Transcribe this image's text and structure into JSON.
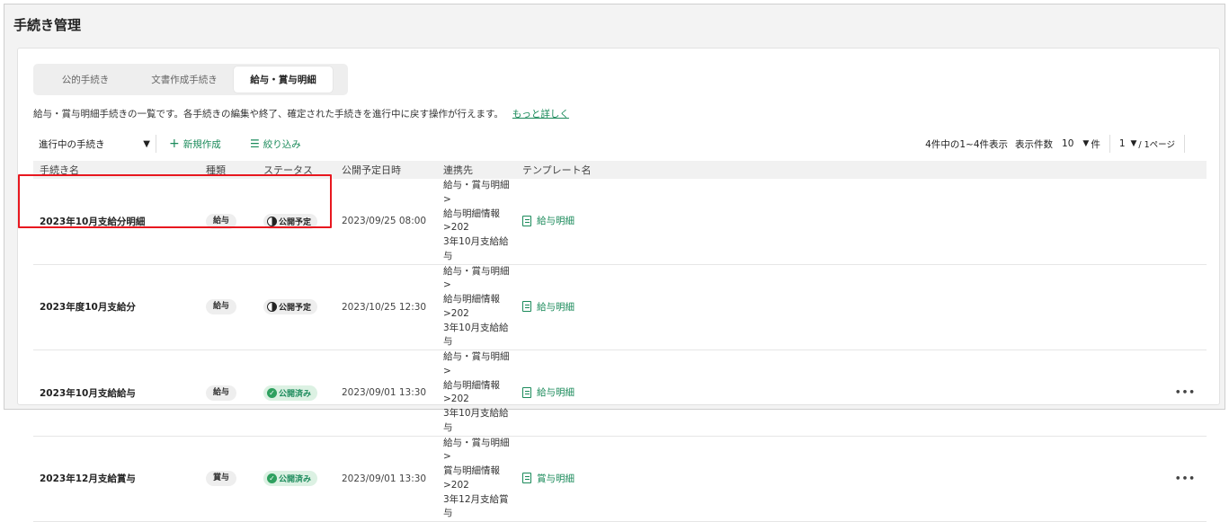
{
  "page": {
    "title": "手続き管理"
  },
  "tabs": [
    {
      "label": "公的手続き",
      "active": false
    },
    {
      "label": "文書作成手続き",
      "active": false
    },
    {
      "label": "給与・賞与明細",
      "active": true
    }
  ],
  "description": {
    "text": "給与・賞与明細手続きの一覧です。各手続きの編集や終了、確定された手続きを進行中に戻す操作が行えます。",
    "link": "もっと詳しく"
  },
  "toolbar": {
    "filter_value": "進行中の手続き",
    "new_label": "新規作成",
    "narrow_label": "絞り込み"
  },
  "pager": {
    "summary": "4件中の1~4件表示",
    "per_page_label": "表示件数",
    "per_page_value": "10",
    "per_page_unit": "件",
    "page_value": "1",
    "page_total": "/ 1ページ"
  },
  "table": {
    "headers": [
      "手続き名",
      "種類",
      "ステータス",
      "公開予定日時",
      "連携先",
      "テンプレート名"
    ],
    "rows": [
      {
        "name": "2023年10月支給分明細",
        "type": "給与",
        "status": "公開予定",
        "status_kind": "scheduled",
        "date": "2023/09/25 08:00",
        "link_1": "給与・賞与明細>",
        "link_2": "給与明細情報>202",
        "link_3": "3年10月支給給与",
        "template": "給与明細",
        "more": ""
      },
      {
        "name": "2023年度10月支給分",
        "type": "給与",
        "status": "公開予定",
        "status_kind": "scheduled",
        "date": "2023/10/25 12:30",
        "link_1": "給与・賞与明細>",
        "link_2": "給与明細情報>202",
        "link_3": "3年10月支給給与",
        "template": "給与明細",
        "more": ""
      },
      {
        "name": "2023年10月支給給与",
        "type": "給与",
        "status": "公開済み",
        "status_kind": "published",
        "date": "2023/09/01 13:30",
        "link_1": "給与・賞与明細>",
        "link_2": "給与明細情報>202",
        "link_3": "3年10月支給給与",
        "template": "給与明細",
        "more": "•••"
      },
      {
        "name": "2023年12月支給賞与",
        "type": "賞与",
        "status": "公開済み",
        "status_kind": "published",
        "date": "2023/09/01 13:30",
        "link_1": "給与・賞与明細>",
        "link_2": "賞与明細情報>202",
        "link_3": "3年12月支給賞与",
        "template": "賞与明細",
        "more": "•••"
      }
    ]
  },
  "colors": {
    "accent": "#1a8a5a",
    "highlight": "#e8171f",
    "published_bg": "#dcf1e3"
  }
}
